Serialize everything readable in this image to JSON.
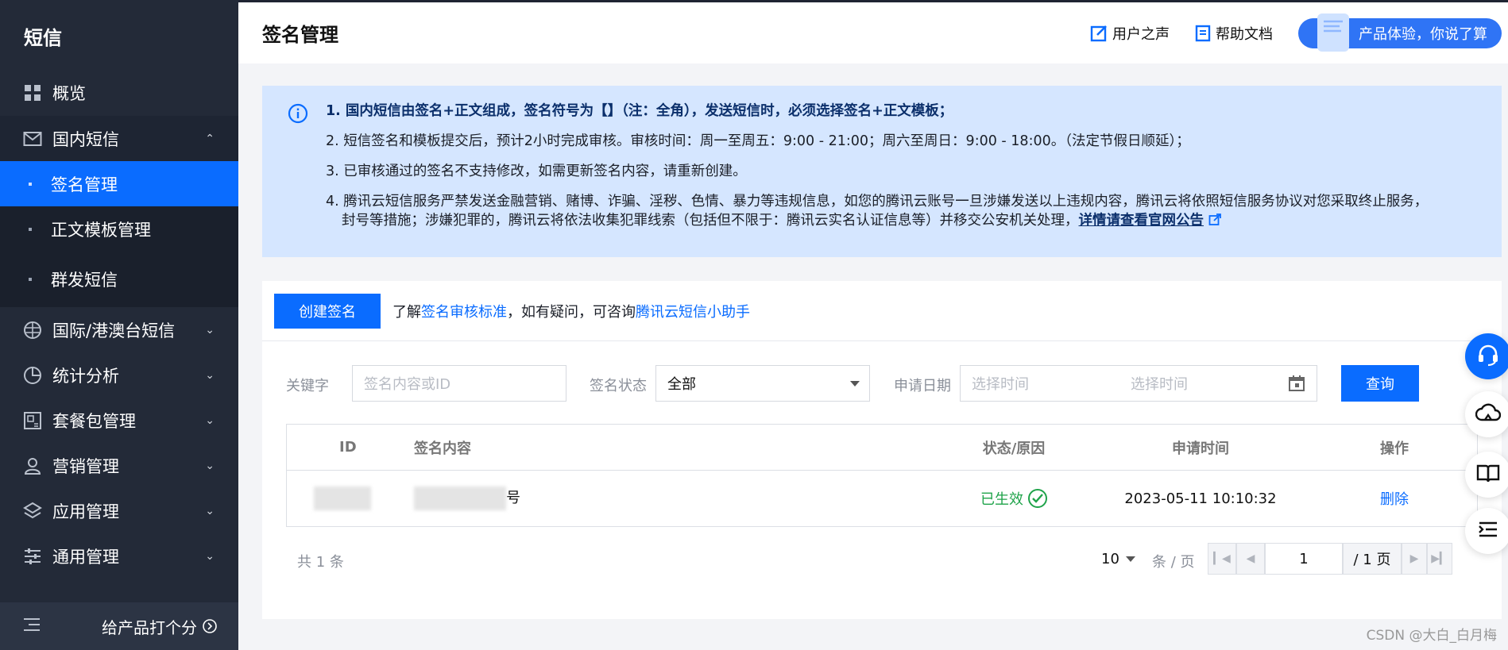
{
  "sidebar": {
    "brand": "短信",
    "items": [
      {
        "label": "概览",
        "icon": "grid-icon"
      },
      {
        "label": "国内短信",
        "icon": "mail-icon",
        "expanded": true
      },
      {
        "label": "国际/港澳台短信",
        "icon": "globe-icon"
      },
      {
        "label": "统计分析",
        "icon": "pie-chart-icon"
      },
      {
        "label": "套餐包管理",
        "icon": "package-icon"
      },
      {
        "label": "营销管理",
        "icon": "user-icon"
      },
      {
        "label": "应用管理",
        "icon": "layers-icon"
      },
      {
        "label": "通用管理",
        "icon": "sliders-icon"
      }
    ],
    "sub_items": [
      {
        "label": "签名管理",
        "active": true
      },
      {
        "label": "正文模板管理"
      },
      {
        "label": "群发短信"
      }
    ],
    "footer_label": "给产品打个分",
    "active_color": "#0a6cff"
  },
  "header": {
    "title": "签名管理",
    "user_voice": "用户之声",
    "help_docs": "帮助文档",
    "feedback": "产品体验，你说了算"
  },
  "notice": {
    "items": [
      "1. 国内短信由签名+正文组成，签名符号为【】（注：全角），发送短信时，必须选择签名+正文模板；",
      "2. 短信签名和模板提交后，预计2小时完成审核。审核时间：周一至周五：9:00 - 21:00；周六至周日：9:00 - 18:00。（法定节假日顺延）；",
      "3. 已审核通过的签名不支持修改，如需更新签名内容，请重新创建。",
      "4. 腾讯云短信服务严禁发送金融营销、赌博、诈骗、淫秽、色情、暴力等违规信息，如您的腾讯云账号一旦涉嫌发送以上违规内容，腾讯云将依照短信服务协议对您采取终止服务，封号等措施；涉嫌犯罪的，腾讯云将依法收集犯罪线索（包括但不限于：腾讯云实名认证信息等）并移交公安机关处理，"
    ],
    "link": "详情请查看官网公告"
  },
  "toolbar": {
    "create_label": "创建签名",
    "hint_prefix": "了解",
    "hint_link1": "签名审核标准",
    "hint_middle": "，如有疑问，可咨询",
    "hint_link2": "腾讯云短信小助手"
  },
  "filters": {
    "keyword_label": "关键字",
    "keyword_placeholder": "签名内容或ID",
    "status_label": "签名状态",
    "status_value": "全部",
    "date_label": "申请日期",
    "date_start_placeholder": "选择时间",
    "date_end_placeholder": "选择时间",
    "query_label": "查询"
  },
  "table": {
    "headers": [
      "ID",
      "签名内容",
      "状态/原因",
      "申请时间",
      "操作"
    ],
    "rows": [
      {
        "content_suffix": "号",
        "status": "已生效",
        "time": "2023-05-11 10:10:32",
        "action": "删除"
      }
    ]
  },
  "pagination": {
    "total": "共 1 条",
    "page_size": "10",
    "per_page": "条 / 页",
    "current": "1",
    "total_pages": "/ 1 页"
  },
  "watermark": "CSDN @大白_白月梅"
}
